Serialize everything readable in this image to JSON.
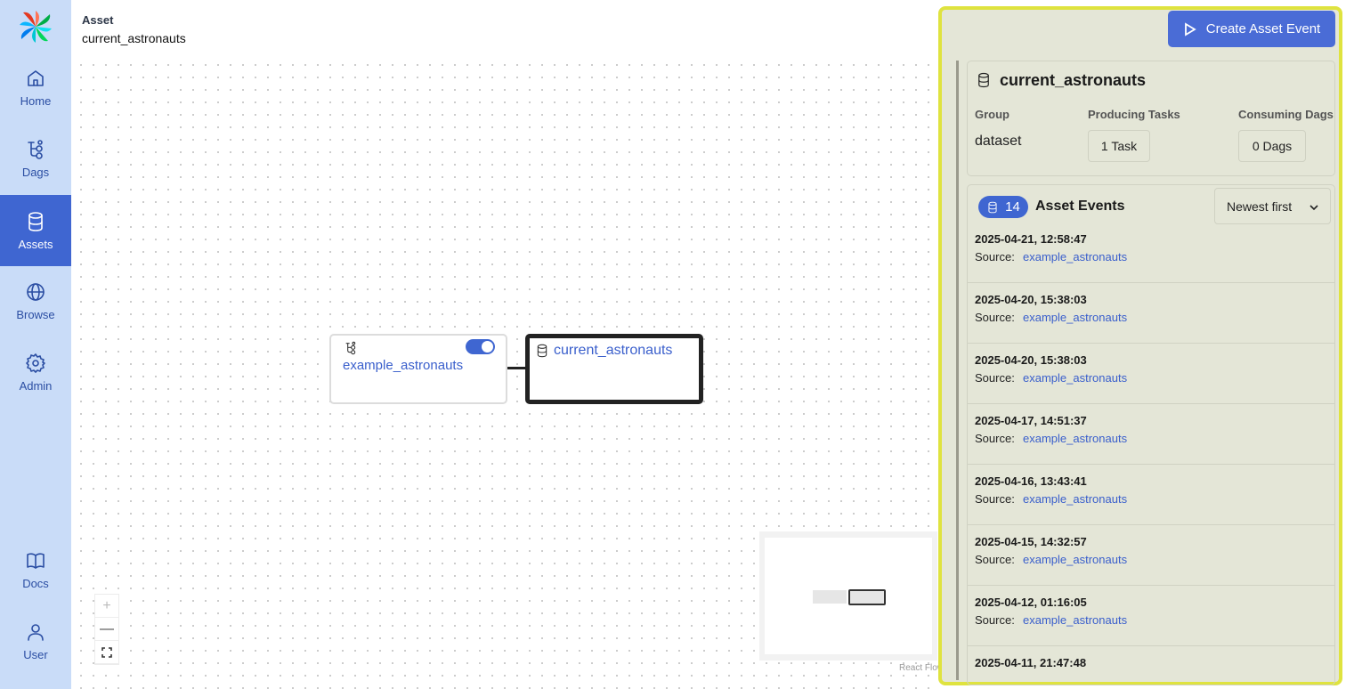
{
  "sidebar": {
    "items": [
      {
        "label": "Home",
        "icon": "home-icon"
      },
      {
        "label": "Dags",
        "icon": "dag-icon"
      },
      {
        "label": "Assets",
        "icon": "database-icon",
        "active": true
      },
      {
        "label": "Browse",
        "icon": "globe-icon"
      },
      {
        "label": "Admin",
        "icon": "gear-icon"
      },
      {
        "label": "Docs",
        "icon": "book-icon"
      },
      {
        "label": "User",
        "icon": "user-icon"
      }
    ]
  },
  "header": {
    "breadcrumb": "Asset",
    "title": "current_astronauts"
  },
  "graph": {
    "dag_node": {
      "label": "example_astronauts",
      "toggle_on": true
    },
    "asset_node": {
      "label": "current_astronauts"
    },
    "attribution": "React Flow"
  },
  "panel": {
    "create_button": "Create Asset Event",
    "asset_name": "current_astronauts",
    "labels": {
      "group": "Group",
      "producing": "Producing Tasks",
      "consuming": "Consuming Dags"
    },
    "values": {
      "group": "dataset",
      "producing": "1 Task",
      "consuming": "0 Dags"
    },
    "events": {
      "count": "14",
      "title": "Asset Events",
      "sort": "Newest first",
      "source_label": "Source:",
      "items": [
        {
          "timestamp": "2025-04-21, 12:58:47",
          "source": "example_astronauts"
        },
        {
          "timestamp": "2025-04-20, 15:38:03",
          "source": "example_astronauts"
        },
        {
          "timestamp": "2025-04-20, 15:38:03",
          "source": "example_astronauts"
        },
        {
          "timestamp": "2025-04-17, 14:51:37",
          "source": "example_astronauts"
        },
        {
          "timestamp": "2025-04-16, 13:43:41",
          "source": "example_astronauts"
        },
        {
          "timestamp": "2025-04-15, 14:32:57",
          "source": "example_astronauts"
        },
        {
          "timestamp": "2025-04-12, 01:16:05",
          "source": "example_astronauts"
        },
        {
          "timestamp": "2025-04-11, 21:47:48",
          "source": ""
        }
      ]
    }
  },
  "colors": {
    "accent": "#3f66d1",
    "sidebar_bg": "#c9dcf8",
    "panel_bg": "#e4e6d7",
    "panel_highlight": "#dfe33f",
    "link": "#3a5fcc"
  }
}
